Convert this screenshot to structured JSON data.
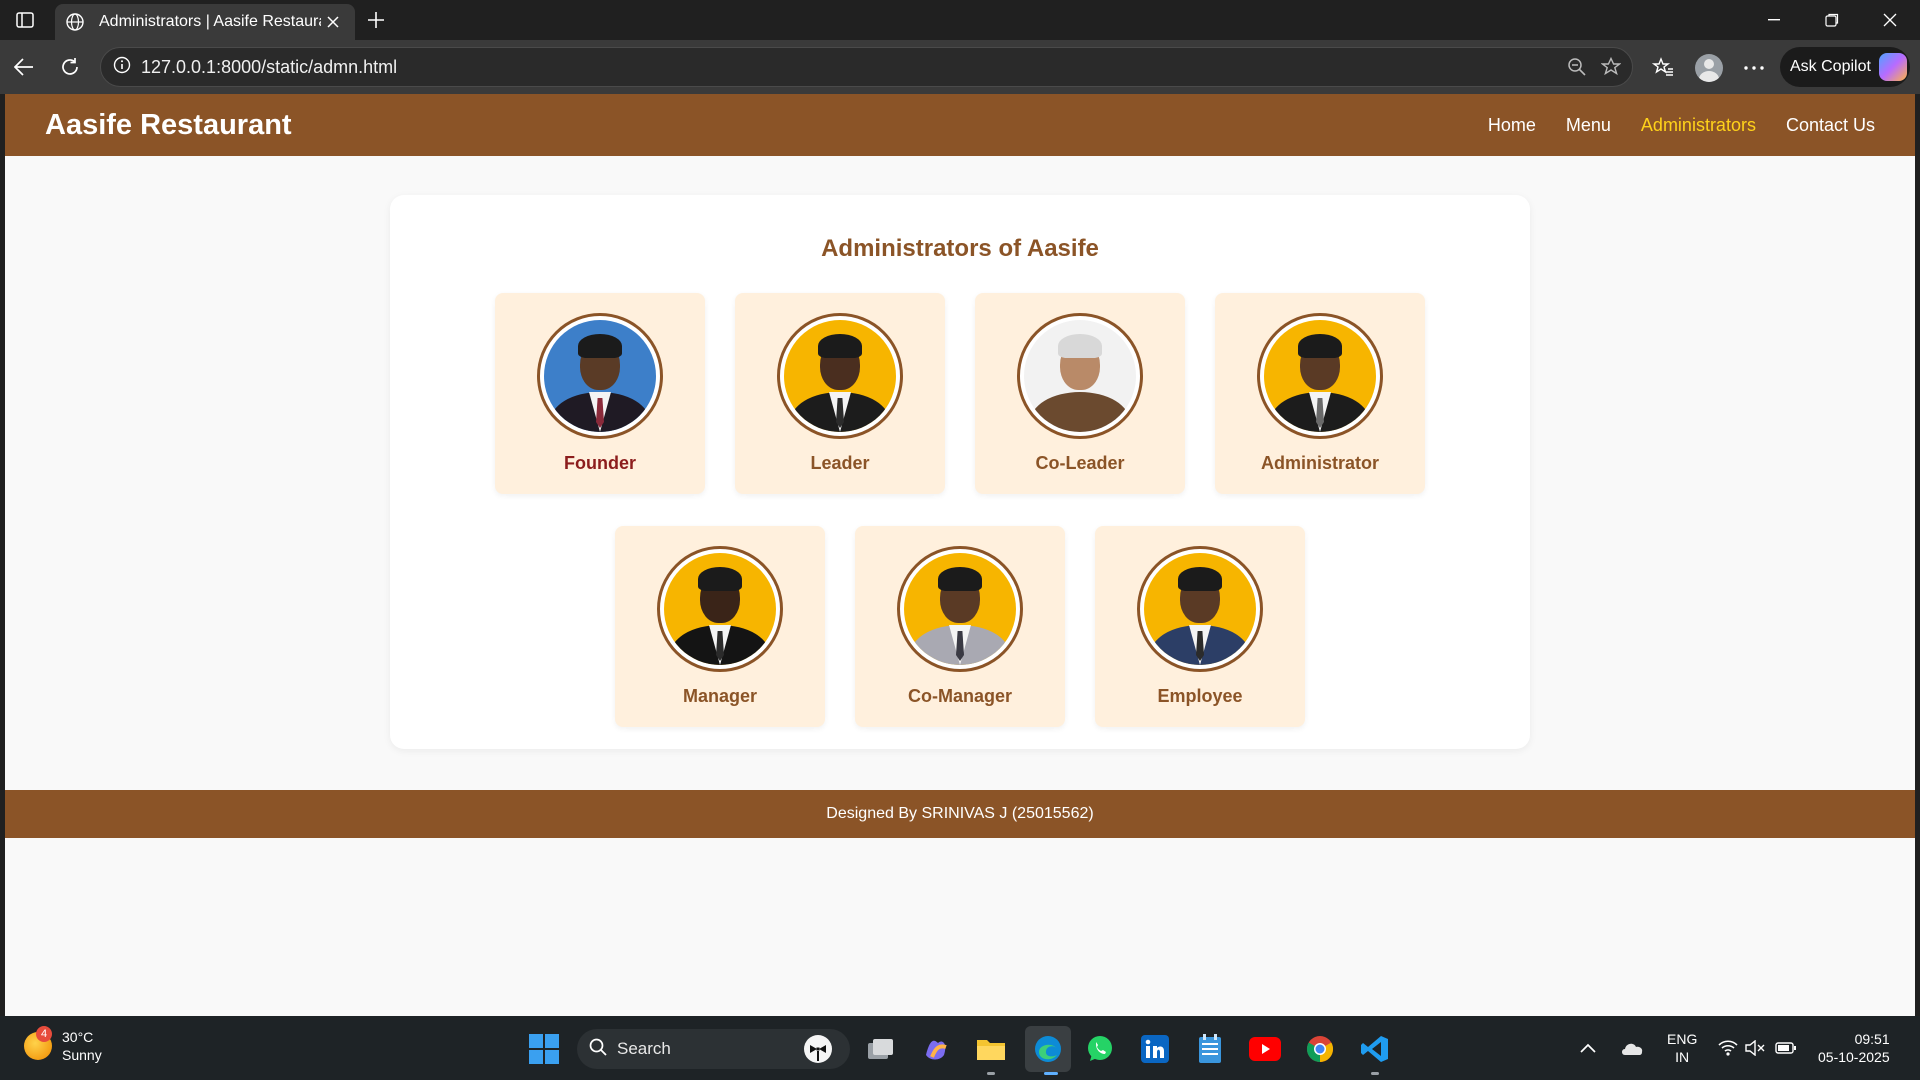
{
  "browser": {
    "tab_title": "Administrators | Aasife Restaurant",
    "url": "127.0.0.1:8000/static/admn.html",
    "copilot_label": "Ask Copilot"
  },
  "site": {
    "brand": "Aasife Restaurant",
    "nav": [
      {
        "label": "Home",
        "active": false
      },
      {
        "label": "Menu",
        "active": false
      },
      {
        "label": "Administrators",
        "active": true
      },
      {
        "label": "Contact Us",
        "active": false
      }
    ],
    "heading": "Administrators of Aasife",
    "members": [
      {
        "role": "Founder"
      },
      {
        "role": "Leader"
      },
      {
        "role": "Co-Leader"
      },
      {
        "role": "Administrator"
      },
      {
        "role": "Manager"
      },
      {
        "role": "Co-Manager"
      },
      {
        "role": "Employee"
      }
    ],
    "footer": "Designed By SRINIVAS J (25015562)"
  },
  "colors": {
    "brand_brown": "#8b5427",
    "nav_active": "#ffd21a",
    "card_bg": "#fff0dd",
    "founder_label": "#8c1d1d"
  },
  "taskbar": {
    "weather_temp": "30°C",
    "weather_desc": "Sunny",
    "weather_badge": "4",
    "search_placeholder": "Search",
    "lang_top": "ENG",
    "lang_bottom": "IN",
    "time": "09:51",
    "date": "05-10-2025"
  }
}
